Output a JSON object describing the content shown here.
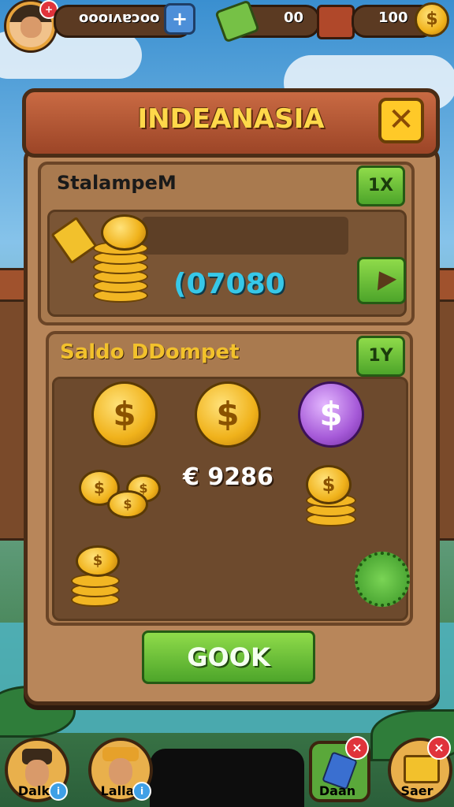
{
  "hud": {
    "player_name": "oooıʌɐɔoo",
    "plus_label": "+",
    "gem_count": "00",
    "coin_count": "100"
  },
  "dialog": {
    "title": "INDEANASIA",
    "close_label": "✕",
    "section1": {
      "label": "StalampeM",
      "badge": "1X",
      "amount": "(07080"
    },
    "section2": {
      "label": "Saldo DDompet",
      "badge": "1Y",
      "amount": "€ 9286",
      "coin_symbol": "$"
    },
    "ok_button": "GOOK"
  },
  "bottom_bar": {
    "items": [
      {
        "label": "Dalk"
      },
      {
        "label": "Lalla"
      },
      {
        "label": "Daan"
      },
      {
        "label": "Saer"
      }
    ]
  },
  "colors": {
    "title_text": "#ffd84a",
    "amount_cyan": "#37c8e8",
    "accent_green": "#5cb531"
  }
}
